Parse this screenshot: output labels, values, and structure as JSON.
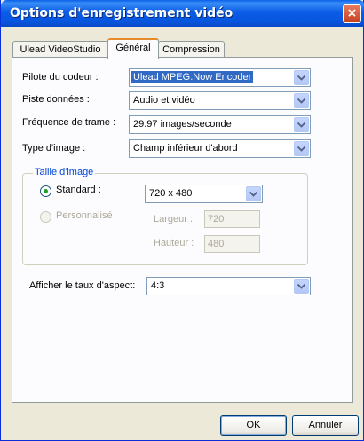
{
  "window": {
    "title": "Options d'enregistrement vidéo",
    "close_glyph": "×"
  },
  "tabs": [
    {
      "label": "Ulead VideoStudio",
      "active": false
    },
    {
      "label": "Général",
      "active": true
    },
    {
      "label": "Compression",
      "active": false
    }
  ],
  "general": {
    "codec_driver": {
      "label": "Pilote du codeur :",
      "value": "Ulead MPEG.Now Encoder"
    },
    "data_track": {
      "label": "Piste données :",
      "value": "Audio et vidéo"
    },
    "frame_rate": {
      "label": "Fréquence de trame :",
      "value": "29.97 images/seconde"
    },
    "frame_type": {
      "label": "Type d'image :",
      "value": "Champ inférieur d'abord"
    },
    "frame_size": {
      "group_title": "Taille d'image",
      "standard_label": "Standard :",
      "standard_value": "720 x 480",
      "standard_selected": true,
      "custom_label": "Personnalisé",
      "width_label": "Largeur :",
      "width_value": "720",
      "height_label": "Hauteur :",
      "height_value": "480"
    },
    "aspect_ratio": {
      "label": "Afficher le taux d'aspect:",
      "value": "4:3"
    }
  },
  "buttons": {
    "ok": "OK",
    "cancel": "Annuler"
  },
  "colors": {
    "titlebar": "#0a5fe8",
    "selection": "#316ac5",
    "group_title": "#0046d5",
    "active_tab_accent": "#e68b2c"
  }
}
